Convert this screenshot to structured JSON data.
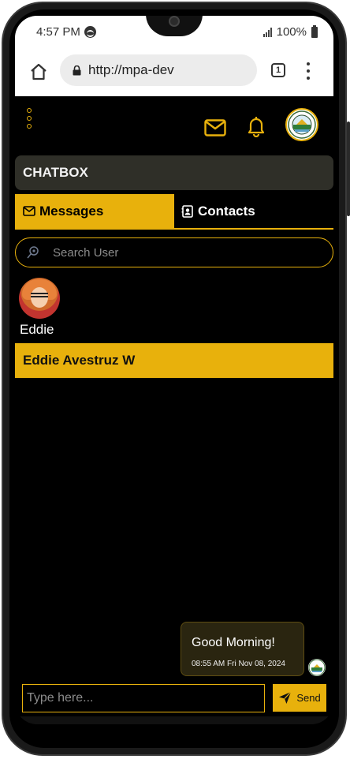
{
  "statusbar": {
    "time": "4:57 PM",
    "battery": "100%",
    "icons": [
      "spotify-icon",
      "signal-icon",
      "battery-icon"
    ]
  },
  "browser": {
    "url": "http://mpa-dev",
    "tab_count": "1",
    "icons": [
      "home-icon",
      "lock-icon",
      "tab-switcher-icon",
      "more-vert-icon"
    ]
  },
  "appbar": {
    "icons": [
      "menu-dots-icon",
      "mail-icon",
      "bell-icon",
      "organization-logo"
    ]
  },
  "chatbox": {
    "title": "CHATBOX"
  },
  "tabs": {
    "messages": "Messages",
    "contacts": "Contacts"
  },
  "search": {
    "placeholder": "Search User"
  },
  "user": {
    "name": "Eddie"
  },
  "contact": {
    "name": "Eddie Avestruz W"
  },
  "message": {
    "text": "Good Morning!",
    "time": "08:55 AM Fri Nov 08, 2024"
  },
  "composer": {
    "placeholder": "Type here...",
    "send_label": "Send"
  },
  "colors": {
    "accent": "#e8b10c",
    "background": "#000000",
    "header": "#2f2f28"
  }
}
